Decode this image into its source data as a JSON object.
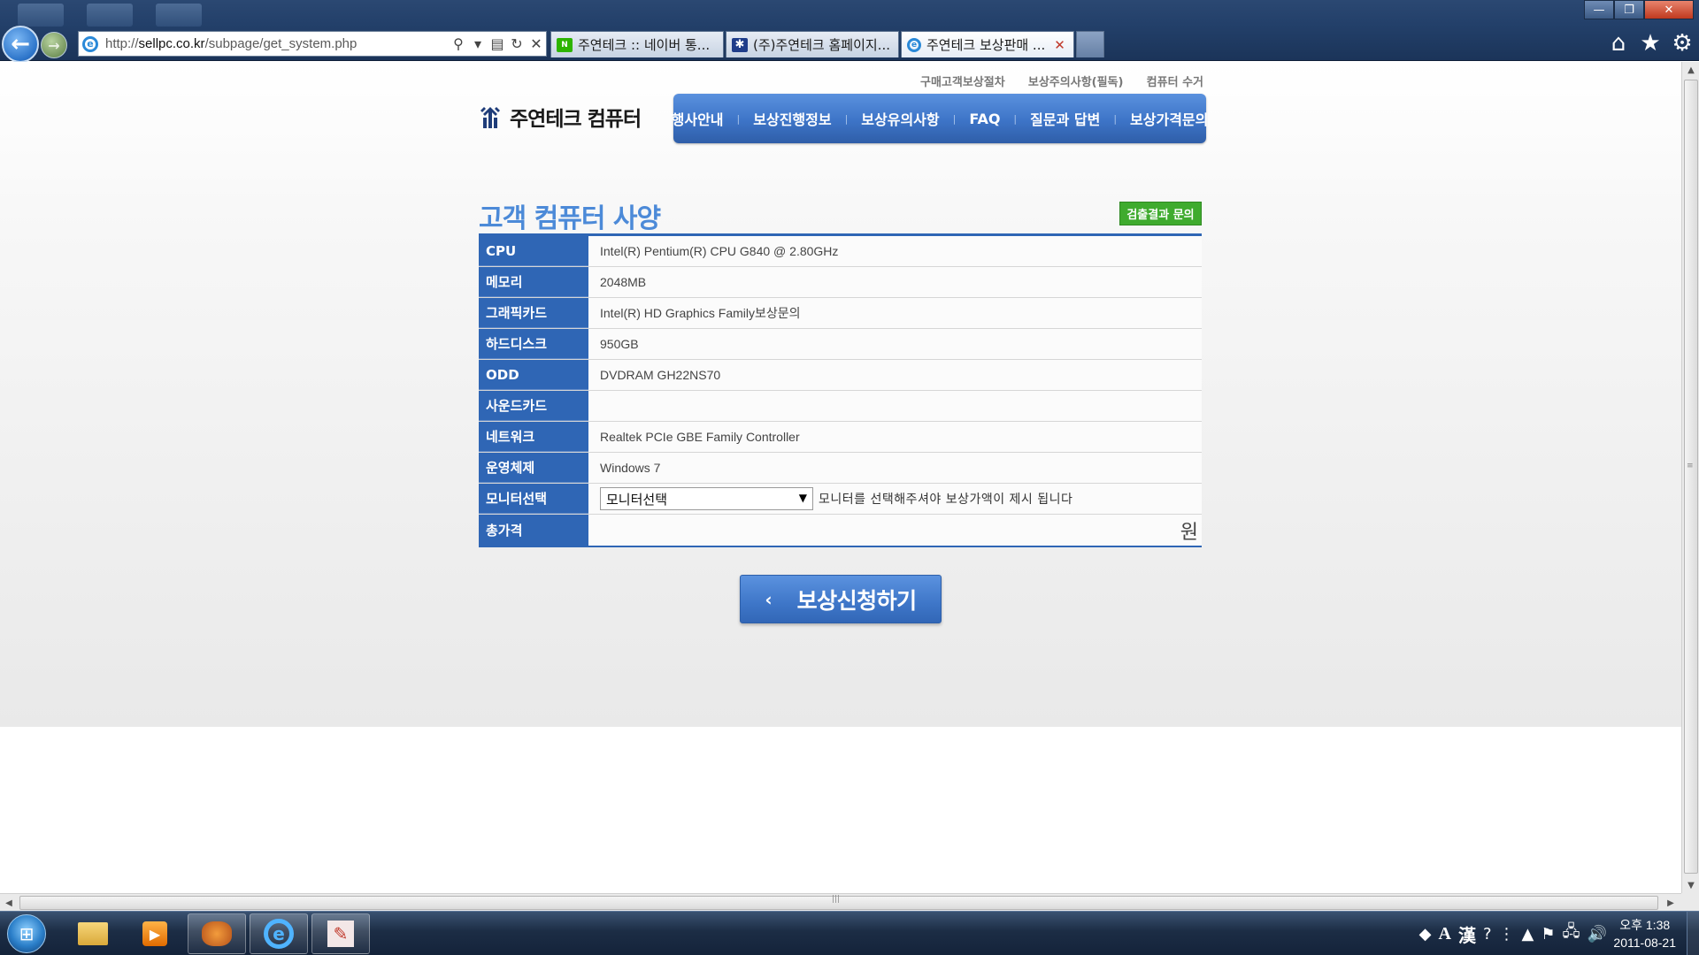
{
  "browser": {
    "url_prefix": "http://",
    "url_domain": "sellpc.co.kr",
    "url_path": "/subpage/get_system.php",
    "tabs": [
      {
        "label": "주연테크 :: 네이버 통...",
        "icon": "naver-icon"
      },
      {
        "label": "(주)주연테크 홈페이지...",
        "icon": "jooyon-star-icon"
      },
      {
        "label": "주연테크 보상판매 ...",
        "icon": "ie-icon",
        "active": true
      }
    ],
    "window_controls": {
      "minimize": "—",
      "maximize": "❐",
      "close": "✕"
    }
  },
  "header": {
    "top_links": [
      "구매고객보상절차",
      "보상주의사항(필독)",
      "컴퓨터 수거"
    ],
    "logo_text": "주연테크 컴퓨터",
    "nav": [
      "행사안내",
      "보상진행정보",
      "보상유의사항",
      "FAQ",
      "질문과 답변",
      "보상가격문의"
    ]
  },
  "main": {
    "title": "고객 컴퓨터 사양",
    "inquiry_button": "검출결과 문의",
    "specs": [
      {
        "label": "CPU",
        "value": "Intel(R) Pentium(R) CPU G840 @ 2.80GHz"
      },
      {
        "label": "메모리",
        "value": "2048MB"
      },
      {
        "label": "그래픽카드",
        "value": "Intel(R) HD Graphics Family보상문의"
      },
      {
        "label": "하드디스크",
        "value": "950GB"
      },
      {
        "label": "ODD",
        "value": "DVDRAM GH22NS70"
      },
      {
        "label": "사운드카드",
        "value": ""
      },
      {
        "label": "네트워크",
        "value": "Realtek PCIe GBE Family Controller"
      },
      {
        "label": "운영체제",
        "value": "Windows 7"
      }
    ],
    "monitor": {
      "label": "모니터선택",
      "selected": "모니터선택",
      "hint": "모니터를 선택해주셔야 보상가액이 제시 됩니다"
    },
    "total": {
      "label": "총가격",
      "value": "",
      "unit": "원"
    },
    "apply_button": "보상신청하기"
  },
  "taskbar": {
    "clock_time": "오후 1:38",
    "clock_date": "2011-08-21",
    "ime_a": "A",
    "ime_han": "漢"
  },
  "colors": {
    "brand_blue": "#2f66b5",
    "title_blue": "#4c8ad8",
    "inquiry_green": "#3fab2e"
  }
}
